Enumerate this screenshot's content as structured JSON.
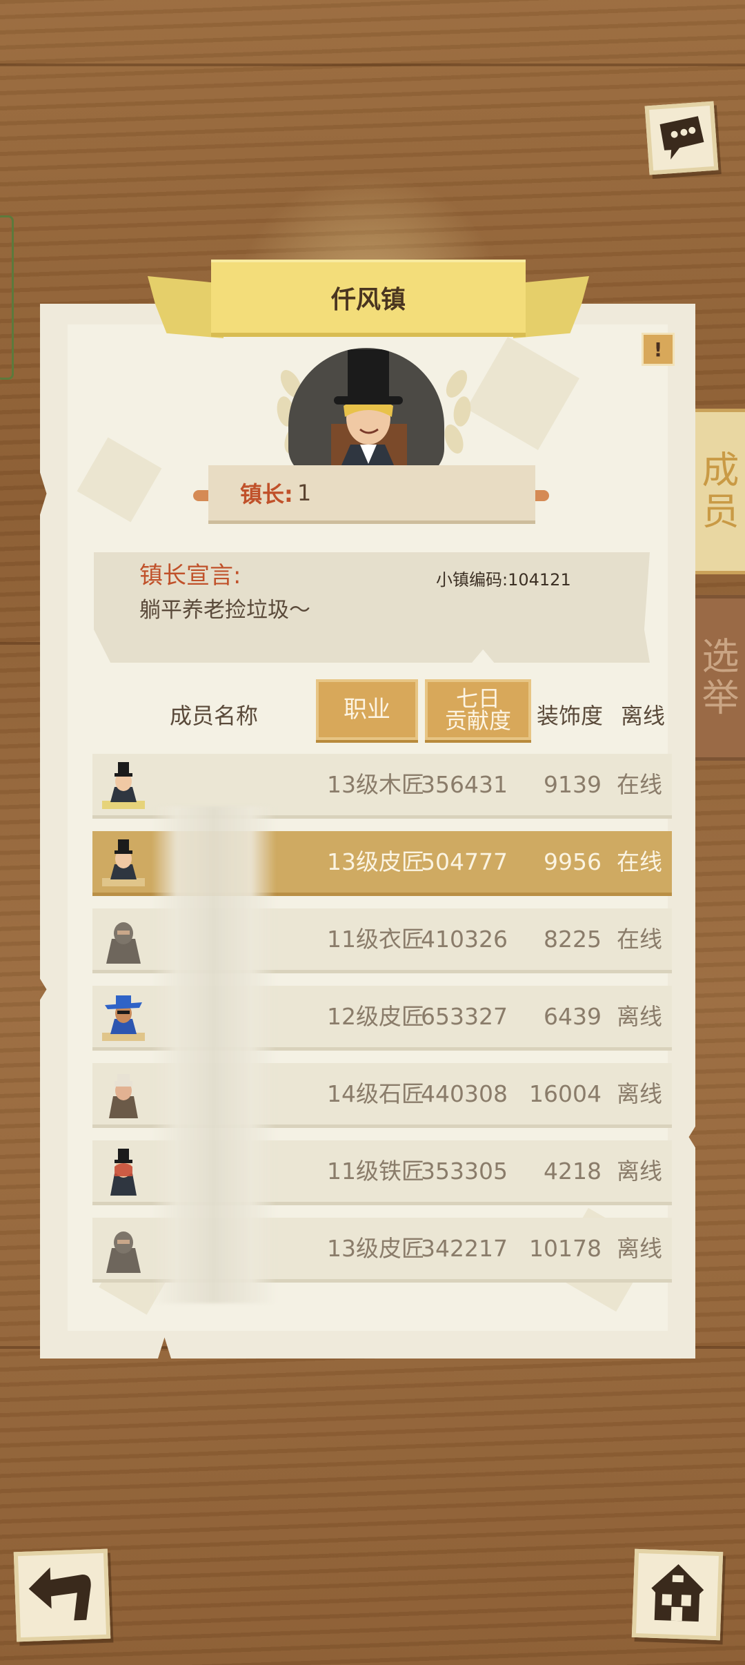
{
  "town": {
    "name": "仟风镇"
  },
  "mayor": {
    "label": "镇长:",
    "value": "1"
  },
  "declaration": {
    "title": "镇长宣言:",
    "text": "躺平养老捡垃圾～"
  },
  "town_code": {
    "label": "小镇编码:",
    "value": "104121"
  },
  "side_tabs": {
    "members": "成员",
    "election": "选举"
  },
  "table": {
    "headers": {
      "name": "成员名称",
      "job": "职业",
      "contrib_line1": "七日",
      "contrib_line2": "贡献度",
      "decor": "装饰度",
      "status": "离线"
    },
    "rows": [
      {
        "job": "13级木匠",
        "contrib": "356431",
        "decor": "9139",
        "status": "在线"
      },
      {
        "job": "13级皮匠",
        "contrib": "504777",
        "decor": "9956",
        "status": "在线"
      },
      {
        "job": "11级衣匠",
        "contrib": "410326",
        "decor": "8225",
        "status": "在线"
      },
      {
        "job": "12级皮匠",
        "contrib": "653327",
        "decor": "6439",
        "status": "离线"
      },
      {
        "job": "14级石匠",
        "contrib": "440308",
        "decor": "16004",
        "status": "离线"
      },
      {
        "job": "11级铁匠",
        "contrib": "353305",
        "decor": "4218",
        "status": "离线"
      },
      {
        "job": "13级皮匠",
        "contrib": "342217",
        "decor": "10178",
        "status": "离线"
      }
    ]
  },
  "icons": {
    "chat": "chat-bubble-icon",
    "warning": "warning-icon",
    "back": "back-arrow-icon",
    "home": "home-icon"
  }
}
